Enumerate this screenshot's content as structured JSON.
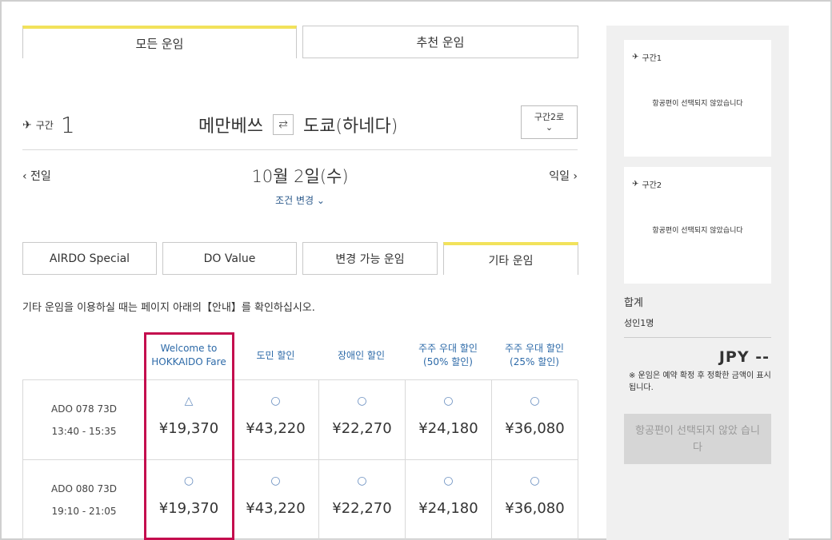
{
  "tabs": {
    "all": "모든 운임",
    "recommended": "추천 운임"
  },
  "segment": {
    "label": "구간",
    "number": "1",
    "next_segment": "구간2로"
  },
  "route": {
    "origin": "메만베쓰",
    "destination": "도쿄(하네다)",
    "swap": "⇄"
  },
  "dates": {
    "prev": "‹  전일",
    "current": "10월 2일(수)",
    "next": "익일  ›",
    "change": "조건 변경 ⌄"
  },
  "fare_tabs": [
    "AIRDO Special",
    "DO Value",
    "변경 가능 운임",
    "기타 운임"
  ],
  "notice": "기타 운임을 이용하실 때는 페이지 아래의【안내】를 확인하십시오.",
  "columns": [
    {
      "line1": "Welcome to",
      "line2": "HOKKAIDO Fare"
    },
    {
      "line1": "도민 할인",
      "line2": ""
    },
    {
      "line1": "장애인 할인",
      "line2": ""
    },
    {
      "line1": "주주 우대 할인",
      "line2": "(50% 할인)"
    },
    {
      "line1": "주주 우대 할인",
      "line2": "(25% 할인)"
    }
  ],
  "flights": [
    {
      "flight": "ADO 078    73D",
      "time": "13:40 - 15:35",
      "fares": [
        {
          "sym": "△",
          "price": "¥19,370"
        },
        {
          "sym": "○",
          "price": "¥43,220"
        },
        {
          "sym": "○",
          "price": "¥22,270"
        },
        {
          "sym": "○",
          "price": "¥24,180"
        },
        {
          "sym": "○",
          "price": "¥36,080"
        }
      ]
    },
    {
      "flight": "ADO 080    73D",
      "time": "19:10 - 21:05",
      "fares": [
        {
          "sym": "○",
          "price": "¥19,370"
        },
        {
          "sym": "○",
          "price": "¥43,220"
        },
        {
          "sym": "○",
          "price": "¥22,270"
        },
        {
          "sym": "○",
          "price": "¥24,180"
        },
        {
          "sym": "○",
          "price": "¥36,080"
        }
      ]
    }
  ],
  "sidebar": {
    "seg1": "구간1",
    "seg2": "구간2",
    "not_selected": "항공편이 선택되지 않았습니다",
    "total_label": "합계",
    "people": "성인1명",
    "total": "JPY --",
    "note": "※ 운임은 예약 확정 후 정확한 금액이 표시됩니다.",
    "button": "항공편이 선택되지 않았 습니다"
  },
  "colors": {
    "accent": "#f2e25b",
    "highlight": "#c40d4e",
    "link": "#2d6aa8"
  }
}
